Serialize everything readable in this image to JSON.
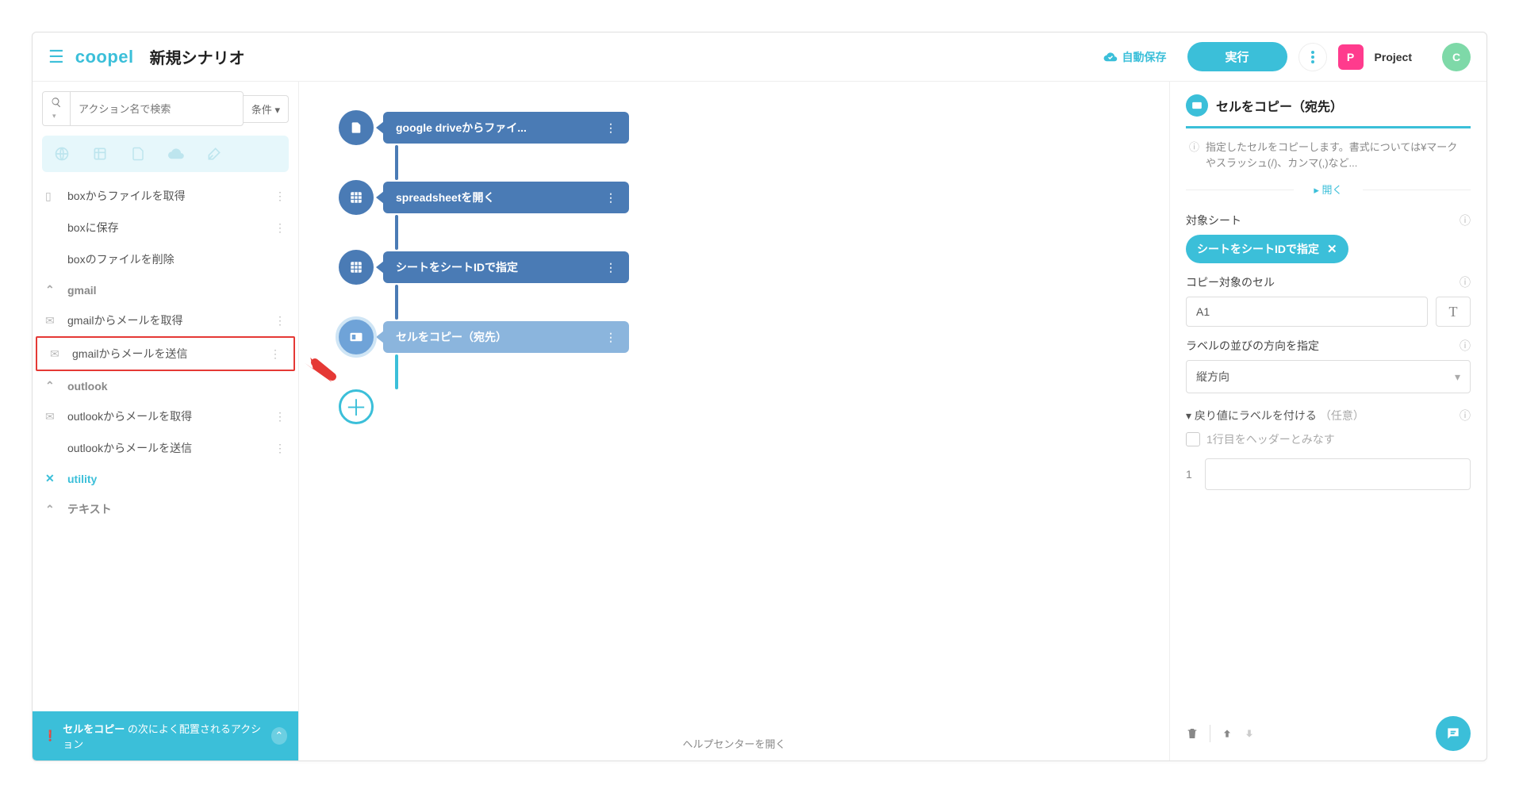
{
  "header": {
    "logo": "coopel",
    "scenario_title": "新規シナリオ",
    "autosave": "自動保存",
    "run": "実行",
    "project_badge": "P",
    "project_label": "Project",
    "avatar": "C"
  },
  "left": {
    "search_placeholder": "アクション名で検索",
    "conditions": "条件 ▾",
    "items": [
      {
        "label": "boxからファイルを取得",
        "type": "item",
        "more": true
      },
      {
        "label": "boxに保存",
        "type": "indent",
        "more": true
      },
      {
        "label": "boxのファイルを削除",
        "type": "indent",
        "more": false
      },
      {
        "label": "gmail",
        "type": "group"
      },
      {
        "label": "gmailからメールを取得",
        "type": "item",
        "more": true
      },
      {
        "label": "gmailからメールを送信",
        "type": "item",
        "more": true,
        "highlight": true
      },
      {
        "label": "outlook",
        "type": "group"
      },
      {
        "label": "outlookからメールを取得",
        "type": "item",
        "more": true
      },
      {
        "label": "outlookからメールを送信",
        "type": "indent",
        "more": true
      },
      {
        "label": "utility",
        "type": "utility"
      },
      {
        "label": "テキスト",
        "type": "group"
      }
    ],
    "footer_strong": "セルをコピー",
    "footer_rest": " の次によく配置されるアクション"
  },
  "canvas": {
    "nodes": [
      {
        "label": "google driveからファイ...",
        "icon": "file"
      },
      {
        "label": "spreadsheetを開く",
        "icon": "sheet"
      },
      {
        "label": "シートをシートIDで指定",
        "icon": "sheet"
      },
      {
        "label": "セルをコピー（宛先）",
        "icon": "cell",
        "selected": true
      }
    ],
    "help": "ヘルプセンターを開く"
  },
  "right": {
    "title": "セルをコピー（宛先）",
    "desc": "指定したセルをコピーします。書式については¥マークやスラッシュ(/)、カンマ(,)など...",
    "open": "▸ 開く",
    "target_sheet_label": "対象シート",
    "chip": "シートをシートIDで指定",
    "cell_label": "コピー対象のセル",
    "cell_value": "A1",
    "dir_label": "ラベルの並びの方向を指定",
    "dir_value": "縦方向",
    "return_label": "戻り値にラベルを付ける",
    "return_opt": "（任意）",
    "return_sub": "▾",
    "checkbox_label": "1行目をヘッダーとみなす",
    "row_num": "1"
  }
}
